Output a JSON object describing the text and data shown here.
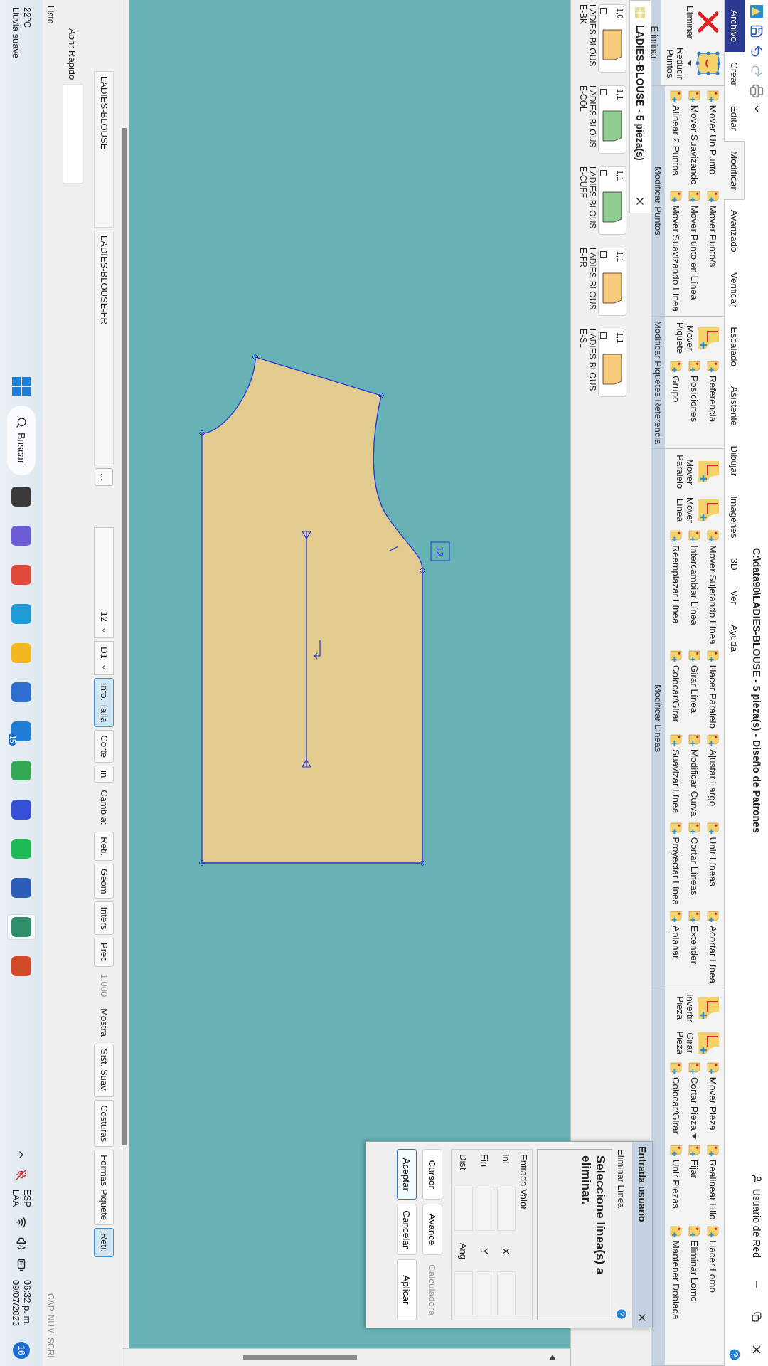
{
  "title_bar": {
    "title": "C:\\data90\\LADIES-BLOUSE  -  5 pieza(s) - Diseño de Patrones",
    "user": "Usuario de Red"
  },
  "menu_tabs": [
    {
      "label": "Archivo",
      "kind": "file",
      "selected": false
    },
    {
      "label": "Crear",
      "kind": "tab",
      "selected": false
    },
    {
      "label": "Editar",
      "kind": "tab",
      "selected": false
    },
    {
      "label": "Modificar",
      "kind": "tab",
      "selected": true
    },
    {
      "label": "Avanzado",
      "kind": "tab",
      "selected": false
    },
    {
      "label": "Verificar",
      "kind": "tab",
      "selected": false
    },
    {
      "label": "Escalado",
      "kind": "tab",
      "selected": false
    },
    {
      "label": "Asistente",
      "kind": "tab",
      "selected": false
    },
    {
      "label": "Dibujar",
      "kind": "tab",
      "selected": false
    },
    {
      "label": "Imágenes",
      "kind": "tab",
      "selected": false
    },
    {
      "label": "3D",
      "kind": "tab",
      "selected": false
    },
    {
      "label": "Ver",
      "kind": "tab",
      "selected": false
    },
    {
      "label": "Ayuda",
      "kind": "tab",
      "selected": false
    }
  ],
  "ribbon_groups": [
    {
      "label": "Eliminar",
      "large_buttons": [
        {
          "label": "Eliminar",
          "kind": "delete",
          "menu": false
        },
        {
          "label": "Reducir Puntos",
          "kind": "dots",
          "menu": true
        }
      ]
    },
    {
      "label": "Modificar Puntos",
      "small_columns": [
        [
          {
            "label": "Mover Un Punto",
            "menu": false
          },
          {
            "label": "Mover Suavizando",
            "menu": false
          },
          {
            "label": "Alinear 2 Puntos",
            "menu": false
          }
        ],
        [
          {
            "label": "Mover Punto/s",
            "menu": false
          },
          {
            "label": "Mover Punto en Línea",
            "menu": false
          },
          {
            "label": "Mover Suavizando Línea",
            "menu": false
          }
        ]
      ]
    },
    {
      "label": "Modificar Piquetes Referencia",
      "large_buttons": [
        {
          "label": "Mover Piquete",
          "kind": "shape",
          "menu": false
        }
      ],
      "small_columns": [
        [
          {
            "label": "Referencia",
            "menu": false
          },
          {
            "label": "Posiciones",
            "menu": false
          },
          {
            "label": "Grupo",
            "menu": false
          }
        ]
      ]
    },
    {
      "label": "Modificar Líneas",
      "large_buttons": [
        {
          "label": "Mover Paralelo",
          "kind": "shape",
          "menu": false
        },
        {
          "label": "Mover Línea",
          "kind": "shape",
          "menu": false
        }
      ],
      "small_columns": [
        [
          {
            "label": "Mover Sujetando Línea",
            "menu": false
          },
          {
            "label": "Intercambiar Línea",
            "menu": false
          },
          {
            "label": "Reemplazar Línea",
            "menu": false
          }
        ],
        [
          {
            "label": "Hacer Paralelo",
            "menu": false
          },
          {
            "label": "Girar Línea",
            "menu": false
          },
          {
            "label": "Colocar/Girar",
            "menu": false
          }
        ],
        [
          {
            "label": "Ajustar Largo",
            "menu": false
          },
          {
            "label": "Modificar Curva",
            "menu": false
          },
          {
            "label": "Suavizar Línea",
            "menu": false
          }
        ],
        [
          {
            "label": "Unir Líneas",
            "menu": false
          },
          {
            "label": "Cortar Líneas",
            "menu": false
          },
          {
            "label": "Proyectar Línea",
            "menu": false
          }
        ],
        [
          {
            "label": "Acortar Línea",
            "menu": false
          },
          {
            "label": "Extender",
            "menu": false
          },
          {
            "label": "Aplanar",
            "menu": false
          }
        ]
      ]
    },
    {
      "large_buttons": [
        {
          "label": "Invertir Pieza",
          "kind": "shape",
          "menu": false
        },
        {
          "label": "Girar Pieza",
          "kind": "shape",
          "menu": false
        }
      ],
      "small_columns": [
        [
          {
            "label": "Mover Pieza",
            "menu": false
          },
          {
            "label": "Cortar Pieza",
            "menu": true
          },
          {
            "label": "Colocar/Girar",
            "menu": false
          }
        ],
        [
          {
            "label": "Realinear Hilo",
            "menu": false
          },
          {
            "label": "Fijar",
            "menu": false
          },
          {
            "label": "Unir Piezas",
            "menu": false
          }
        ],
        [
          {
            "label": "Hacer Lomo",
            "menu": false
          },
          {
            "label": "Eliminar Lomo",
            "menu": false
          },
          {
            "label": "Mantener Doblada",
            "menu": false
          }
        ]
      ]
    }
  ],
  "pieces_panel": {
    "tab": "LADIES-BLOUSE  -  5 pieza(s)",
    "pieces": [
      {
        "count": "1,0",
        "name": "LADIES-BLOUSE-BK",
        "color": "#f7c97a"
      },
      {
        "count": "1,1",
        "name": "LADIES-BLOUSE-COL",
        "color": "#8fcc8f"
      },
      {
        "count": "1,1",
        "name": "LADIES-BLOUSE-CUFF",
        "color": "#8fcc8f"
      },
      {
        "count": "1,1",
        "name": "LADIES-BLOUSE-FR",
        "color": "#f7c97a"
      },
      {
        "count": "1,1",
        "name": "LADIES-BLOUSE-SL",
        "color": "#f7c97a"
      }
    ]
  },
  "canvas": {
    "piece_label": "12"
  },
  "dialog": {
    "title": "Entrada usuario",
    "command": "Eliminar Línea",
    "prompt": "Seleccione línea(s) a eliminar.",
    "group": "Entrada Valor",
    "rows": [
      {
        "label": "Ini",
        "label_2": "X"
      },
      {
        "label": "Fin",
        "label_2": "Y"
      },
      {
        "label": "Dist",
        "label_2": "Ang"
      }
    ],
    "buttons": [
      {
        "label": "Cursor",
        "disabled": false,
        "focused": false
      },
      {
        "label": "Avance",
        "disabled": false,
        "focused": false
      },
      {
        "label": "Calculadora",
        "disabled": true,
        "focused": false
      },
      {
        "label": "Aceptar",
        "disabled": false,
        "focused": true
      },
      {
        "label": "Cancelar",
        "disabled": false,
        "focused": false
      },
      {
        "label": "Aplicar",
        "disabled": false,
        "focused": false
      }
    ]
  },
  "bottom_toolbar": {
    "style_field": "LADIES-BLOUSE",
    "piece_field": "LADIES-BLOUSE-FR",
    "more": "...",
    "size": "12",
    "dim": "D1",
    "buttons": [
      {
        "label": "Info. Talla",
        "kind": "button",
        "on": true
      },
      {
        "label": "Corte",
        "kind": "button",
        "on": false
      },
      {
        "label": "in",
        "kind": "button",
        "on": false
      },
      {
        "label": "Camb a:",
        "kind": "text",
        "on": false
      },
      {
        "label": "Reti.",
        "kind": "button",
        "on": false
      },
      {
        "label": "Geom",
        "kind": "button",
        "on": false
      },
      {
        "label": "Inters",
        "kind": "button",
        "on": false
      },
      {
        "label": "Prec",
        "kind": "button",
        "on": false
      },
      {
        "label": "1.000",
        "kind": "disabled",
        "on": false
      },
      {
        "label": "Mostra",
        "kind": "text",
        "on": false
      },
      {
        "label": "Sist. Suav.",
        "kind": "button",
        "on": false
      },
      {
        "label": "Costuras",
        "kind": "button",
        "on": false
      },
      {
        "label": "Formas Piquete",
        "kind": "button",
        "on": false
      },
      {
        "label": "Reti.",
        "kind": "button",
        "on": true
      }
    ]
  },
  "quick_open": {
    "label": "Abrir Rápido"
  },
  "status_bar": {
    "left": "Listo",
    "indicators": [
      "CAP",
      "NUM",
      "SCRL"
    ]
  },
  "taskbar": {
    "temperature": "22°C",
    "weather": "Lluvia suave",
    "search": "Buscar",
    "apps": [
      {
        "color": "#3a3a3a",
        "selected": false
      },
      {
        "color": "#6b5bd6",
        "selected": false
      },
      {
        "color": "#e04a3a",
        "selected": false
      },
      {
        "color": "#1f9bd6",
        "selected": false
      },
      {
        "color": "#f2b81f",
        "selected": false
      },
      {
        "color": "#2f6fd1",
        "selected": false
      },
      {
        "color": "#1f7fd6",
        "selected": false,
        "badge": "15"
      },
      {
        "color": "#34a853",
        "selected": false
      },
      {
        "color": "#3550d6",
        "selected": false
      },
      {
        "color": "#1db954",
        "selected": false
      },
      {
        "color": "#2b5cb8",
        "selected": false
      },
      {
        "color": "#2f8f6a",
        "selected": true
      },
      {
        "color": "#d04a2a",
        "selected": false
      }
    ],
    "lang": "ESP",
    "layout": "LAA",
    "time": "06:32 p. m.",
    "date": "09/07/2023",
    "notifications": "16"
  }
}
